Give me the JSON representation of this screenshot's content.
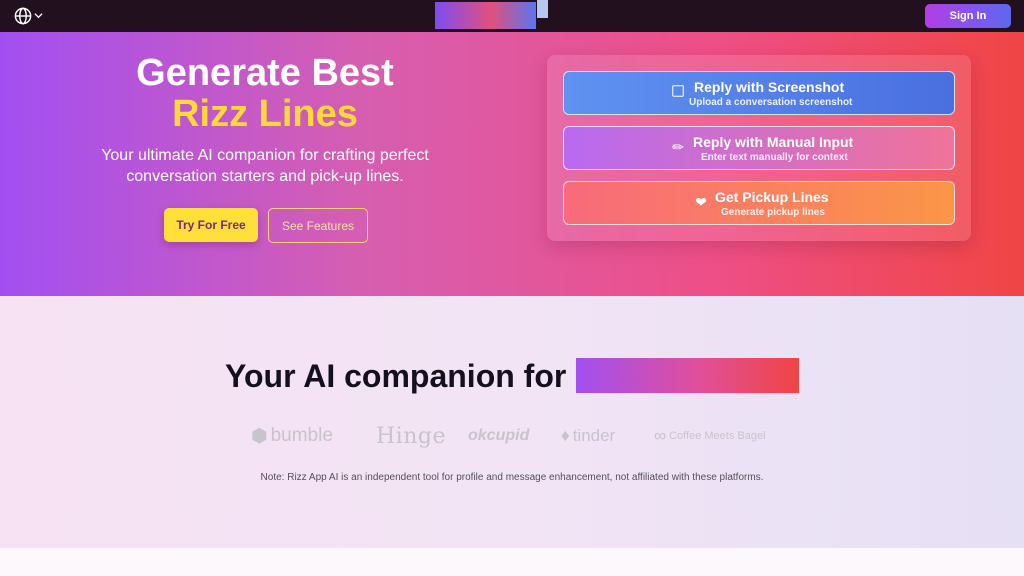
{
  "nav": {
    "language_icon": "globe-icon",
    "sign_in_label": "Sign In",
    "accent_gradient": [
      "#b23ee6",
      "#5e68ee"
    ]
  },
  "hero": {
    "title_line1": "Generate Best",
    "title_line2": "Rizz Lines",
    "subtitle": "Your ultimate AI companion for crafting perfect conversation starters and pick-up lines.",
    "try_label": "Try For Free",
    "features_label": "See Features",
    "accent_color": "#ffd93a",
    "options": [
      {
        "icon": "image-icon",
        "title": "Reply with Screenshot",
        "desc": "Upload a conversation screenshot"
      },
      {
        "icon": "pencil-icon",
        "title": "Reply with Manual Input",
        "desc": "Enter text manually for context"
      },
      {
        "icon": "heart-icon",
        "title": "Get Pickup Lines",
        "desc": "Generate pickup lines"
      }
    ]
  },
  "companion": {
    "heading": "Your AI companion for",
    "logos": [
      "bumble",
      "Hinge",
      "okcupid",
      "tinder",
      "Coffee Meets Bagel"
    ],
    "note": "Note: Rizz App AI is an independent tool for profile and message enhancement, not affiliated with these platforms."
  }
}
